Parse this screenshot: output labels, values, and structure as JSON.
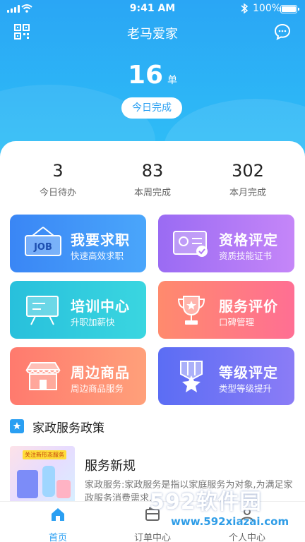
{
  "status_bar": {
    "time": "9:41 AM",
    "battery": "100%"
  },
  "header": {
    "title": "老马爱家",
    "today_count": "16",
    "today_unit": "单",
    "today_button": "今日完成"
  },
  "stats": [
    {
      "value": "3",
      "label": "今日待办"
    },
    {
      "value": "83",
      "label": "本周完成"
    },
    {
      "value": "302",
      "label": "本月完成"
    }
  ],
  "cards": [
    {
      "title": "我要求职",
      "subtitle": "快速高效求职",
      "icon": "job-sign-icon"
    },
    {
      "title": "资格评定",
      "subtitle": "资质技能证书",
      "icon": "certificate-icon"
    },
    {
      "title": "培训中心",
      "subtitle": "升职加薪快",
      "icon": "training-board-icon"
    },
    {
      "title": "服务评价",
      "subtitle": "口碑管理",
      "icon": "trophy-icon"
    },
    {
      "title": "周边商品",
      "subtitle": "周边商品服务",
      "icon": "shop-icon"
    },
    {
      "title": "等级评定",
      "subtitle": "类型等级提升",
      "icon": "level-badge-icon"
    }
  ],
  "section": {
    "title": "家政服务政策"
  },
  "news": [
    {
      "thumb_tag": "关注新形态服务",
      "title": "服务新规",
      "desc": "家政服务:家政服务是指以家庭服务为对象,为满足家政服务消费需求..."
    }
  ],
  "tabbar": [
    {
      "label": "首页",
      "active": true
    },
    {
      "label": "订单中心",
      "active": false
    },
    {
      "label": "个人中心",
      "active": false
    }
  ],
  "watermark": {
    "brand": "592软件园",
    "url": "www.592xiazai.com"
  }
}
